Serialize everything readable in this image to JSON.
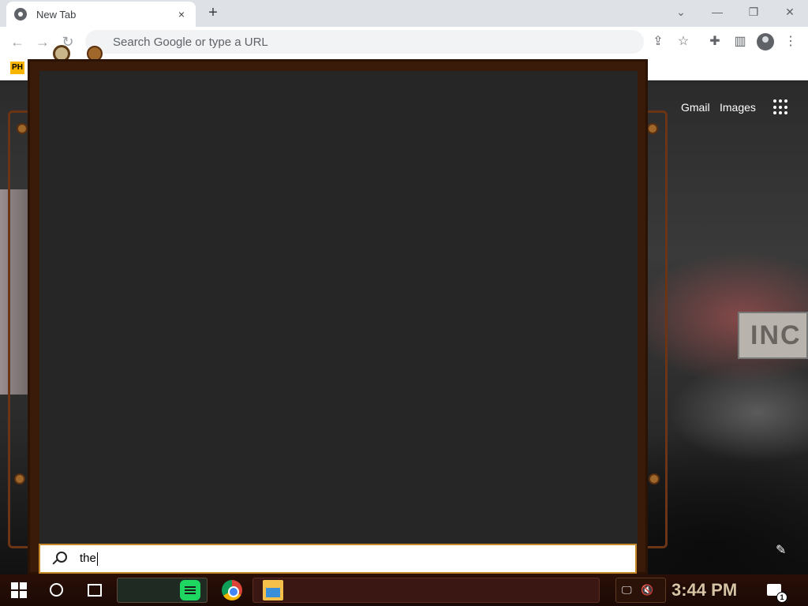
{
  "browser": {
    "tab": {
      "title": "New Tab",
      "close_icon": "×"
    },
    "new_tab_icon": "+",
    "window_controls": {
      "tab_search": "⌄",
      "minimize": "—",
      "restore": "❐",
      "close": "✕"
    },
    "toolbar": {
      "back_icon": "←",
      "forward_icon": "→",
      "reload_icon": "↻",
      "omnibox_placeholder": "Search Google or type a URL",
      "share_icon": "⇪",
      "star_icon": "☆",
      "extensions_icon": "✚",
      "sidepanel_icon": "▥",
      "menu_icon": "⋮"
    },
    "bookmarks": {
      "ph_label": "PH"
    }
  },
  "newtab_page": {
    "gmail_link": "Gmail",
    "images_link": "Images",
    "apps_icon": "apps-grid",
    "customize_icon": "✎",
    "background_sign": "INC"
  },
  "start_menu": {
    "search_value": "the"
  },
  "taskbar": {
    "apps": [
      "Spotify",
      "Google Chrome",
      "File Explorer"
    ],
    "clock": "3:44 PM",
    "notifications_count": "1",
    "tray_network_icon": "🖵",
    "tray_volume_icon": "🔇"
  }
}
